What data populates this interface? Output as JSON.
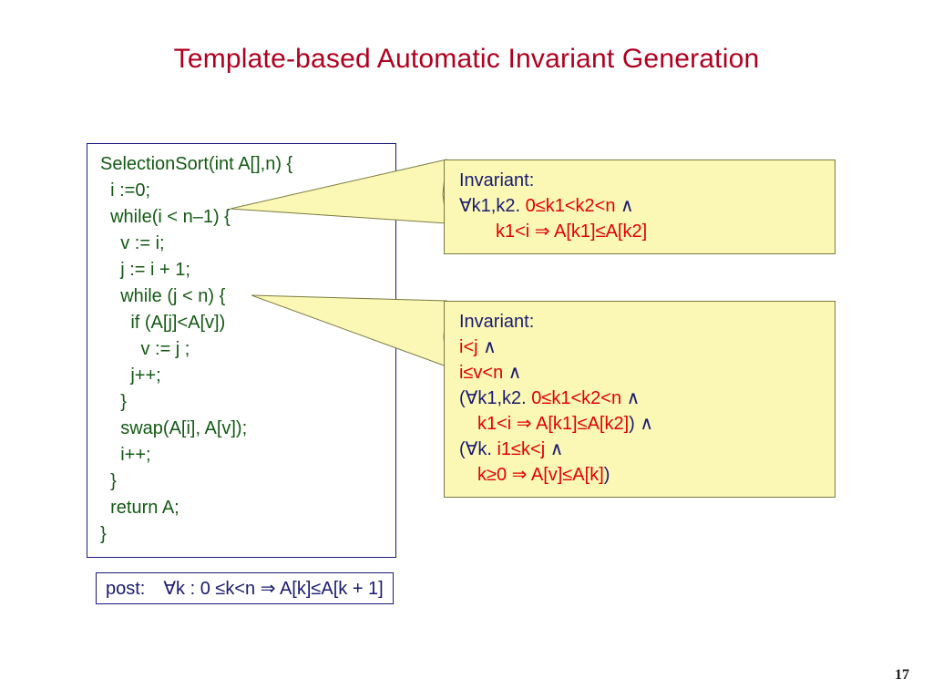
{
  "title": "Template-based Automatic Invariant Generation",
  "code": {
    "l1": "SelectionSort(int A[],n) {",
    "l2": "  i :=0;",
    "l3": "  while(i < n–1) {",
    "l4": "    v := i;",
    "l5": "    j := i + 1;",
    "l6": "    while (j < n) {",
    "l7": "      if (A[j]<A[v])",
    "l8": "        v := j ;",
    "l9": "      j++;",
    "l10": "    }",
    "l11": "    swap(A[i], A[v]);",
    "l12": "    i++;",
    "l13": "  }",
    "l14": "  return A;",
    "l15": "}"
  },
  "post": {
    "label": "post: ",
    "expr": "∀k : 0 ≤k<n ⇒ A[k]≤A[k + 1]"
  },
  "inv1": {
    "head": "Invariant:",
    "quant": "∀k1,k2. ",
    "p1": "0≤k1<k2<n ",
    "wedge": "∧",
    "indent": "  ",
    "p2": "k1<i ⇒ A[k1]≤A[k2]"
  },
  "inv2": {
    "head": "Invariant:",
    "r1": "i<j ",
    "r2": "i≤v<n ",
    "wedge": "∧",
    "open": "(",
    "quant1": "∀k1,k2. ",
    "p1": "0≤k1<k2<n ",
    "indent": " ",
    "p2": "k1<i ⇒ A[k1]≤A[k2]",
    "close1": ") ",
    "quant2": "∀k. ",
    "p3": "i1≤k<j ",
    "p4": "k≥0 ⇒ A[v]≤A[k]",
    "close2": ")"
  },
  "page_number": "17"
}
